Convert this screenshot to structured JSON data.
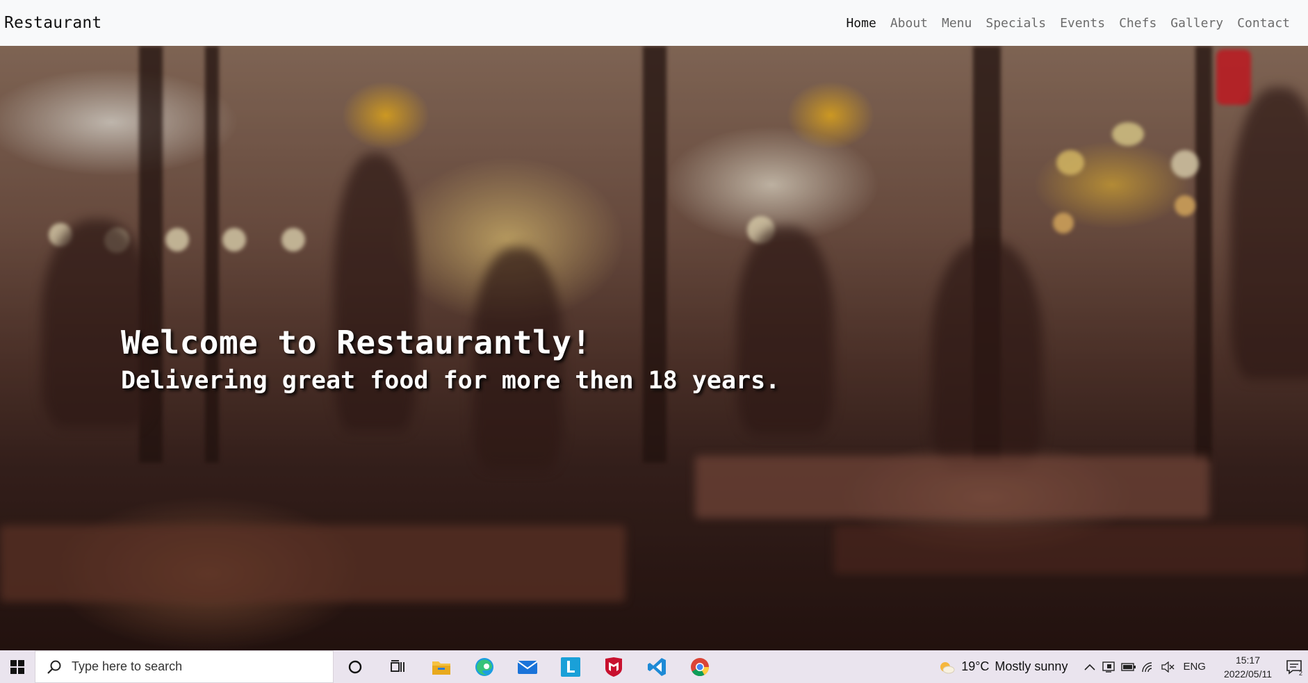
{
  "navbar": {
    "brand": "Restaurant",
    "links": [
      {
        "label": "Home",
        "active": true
      },
      {
        "label": "About",
        "active": false
      },
      {
        "label": "Menu",
        "active": false
      },
      {
        "label": "Specials",
        "active": false
      },
      {
        "label": "Events",
        "active": false
      },
      {
        "label": "Chefs",
        "active": false
      },
      {
        "label": "Gallery",
        "active": false
      },
      {
        "label": "Contact",
        "active": false
      }
    ]
  },
  "hero": {
    "title": "Welcome to Restaurantly!",
    "subtitle": "Delivering great food for more then 18 years."
  },
  "taskbar": {
    "search_placeholder": "Type here to search",
    "apps": [
      "cortana-icon",
      "task-view-icon",
      "file-explorer-icon",
      "edge-icon",
      "mail-icon",
      "l-app-icon",
      "mcafee-icon",
      "vscode-icon",
      "chrome-icon"
    ],
    "weather_temp": "19°C",
    "weather_desc": "Mostly sunny",
    "language": "ENG",
    "time": "15:17",
    "date": "2022/05/11",
    "notification_count": "2"
  },
  "colors": {
    "navbar_bg": "#f8f9fa",
    "nav_active": "#111111",
    "nav_inactive": "#6c6c6c",
    "taskbar_bg": "#eae4ee"
  }
}
